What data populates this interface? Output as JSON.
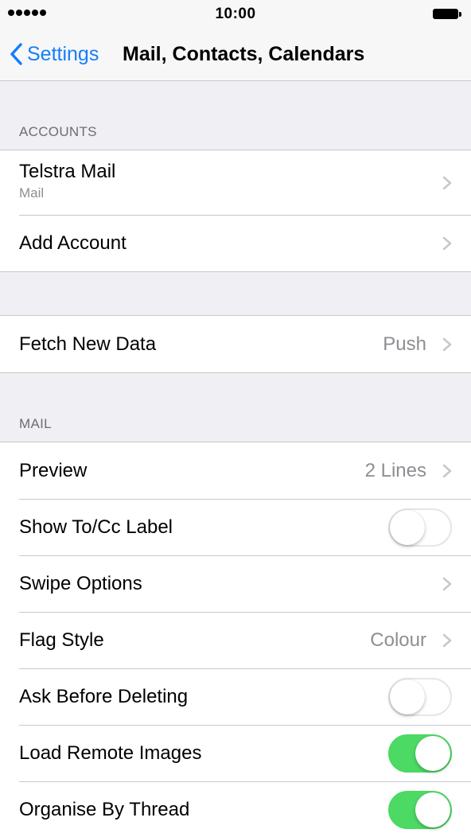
{
  "status_bar": {
    "time": "10:00",
    "signal_dots": 5
  },
  "nav": {
    "back_label": "Settings",
    "title": "Mail, Contacts, Calendars",
    "back_icon": "chevron-left-icon"
  },
  "accounts": {
    "header": "ACCOUNTS",
    "items": [
      {
        "label": "Telstra Mail",
        "subtitle": "Mail"
      },
      {
        "label": "Add Account"
      }
    ]
  },
  "fetch": {
    "label": "Fetch New Data",
    "value": "Push"
  },
  "mail": {
    "header": "MAIL",
    "preview": {
      "label": "Preview",
      "value": "2 Lines"
    },
    "show_to_cc": {
      "label": "Show To/Cc Label",
      "on": false
    },
    "swipe_options": {
      "label": "Swipe Options"
    },
    "flag_style": {
      "label": "Flag Style",
      "value": "Colour"
    },
    "ask_before_deleting": {
      "label": "Ask Before Deleting",
      "on": false
    },
    "load_remote_images": {
      "label": "Load Remote Images",
      "on": true
    },
    "organise_by_thread": {
      "label": "Organise By Thread",
      "on": true
    }
  },
  "colors": {
    "accent": "#147efb",
    "toggle_on": "#4cd964",
    "background": "#efeff4",
    "secondary_text": "#8e8e93"
  }
}
